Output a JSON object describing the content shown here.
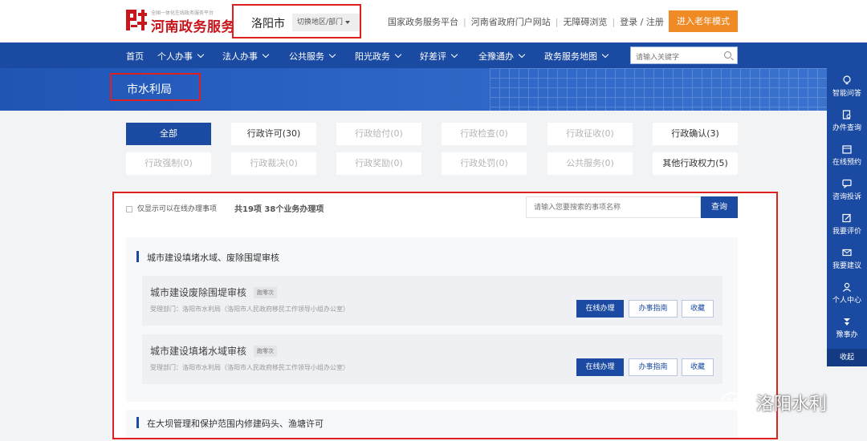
{
  "header": {
    "logo_small": "全国一体化在线政务服务平台",
    "logo_title": "河南政务服务网",
    "city": "洛阳市",
    "switch_label": "切换地区/部门",
    "links": [
      "国家政务服务平台",
      "河南省政府门户网站",
      "无障碍浏览",
      "登录 / 注册"
    ],
    "elder_mode": "进入老年模式"
  },
  "nav": {
    "items": [
      "首页",
      "个人办事",
      "法人办事",
      "公共服务",
      "阳光政务",
      "好差评",
      "全豫通办",
      "政务服务地图"
    ],
    "search_placeholder": "请输入关键字"
  },
  "department": "市水利局",
  "filters": {
    "row1": [
      "全部",
      "行政许可(30)",
      "行政给付(0)",
      "行政检查(0)",
      "行政征收(0)",
      "行政确认(3)"
    ],
    "row2": [
      "行政强制(0)",
      "行政裁决(0)",
      "行政奖励(0)",
      "行政处罚(0)",
      "公共服务(0)",
      "其他行政权力(5)"
    ]
  },
  "results": {
    "online_only_label": "仅显示可以在线办理事项",
    "count_text": "共19项 38个业务办理项",
    "search_placeholder": "请输入您要搜索的事项名称",
    "query_button": "查询",
    "groups": [
      {
        "title": "城市建设填堵水域、废除围堤审核",
        "items": [
          {
            "title": "城市建设废除围堤审核",
            "badge": "跑零次",
            "dept": "受理部门：洛阳市水利局（洛阳市人民政府移民工作领导小组办公室）"
          },
          {
            "title": "城市建设填堵水域审核",
            "badge": "跑零次",
            "dept": "受理部门：洛阳市水利局（洛阳市人民政府移民工作领导小组办公室）"
          }
        ]
      },
      {
        "title": "在大坝管理和保护范围内修建码头、渔塘许可",
        "items": []
      }
    ],
    "buttons": {
      "online": "在线办理",
      "guide": "办事指南",
      "favorite": "收藏"
    }
  },
  "sidebar": {
    "items": [
      "智能问答",
      "办件查询",
      "在线预约",
      "咨询投诉",
      "我要评价",
      "我要建议",
      "个人中心",
      "豫事办"
    ],
    "icons": [
      "bulb-icon",
      "document-search-icon",
      "calendar-icon",
      "chat-icon",
      "edit-icon",
      "mail-icon",
      "user-icon",
      "app-icon"
    ],
    "collapse": "收起"
  },
  "watermark": "洛阳水利",
  "colors": {
    "primary": "#1a4aa2",
    "brand_red": "#c8161d",
    "orange": "#f08a24",
    "highlight": "#e02020"
  }
}
